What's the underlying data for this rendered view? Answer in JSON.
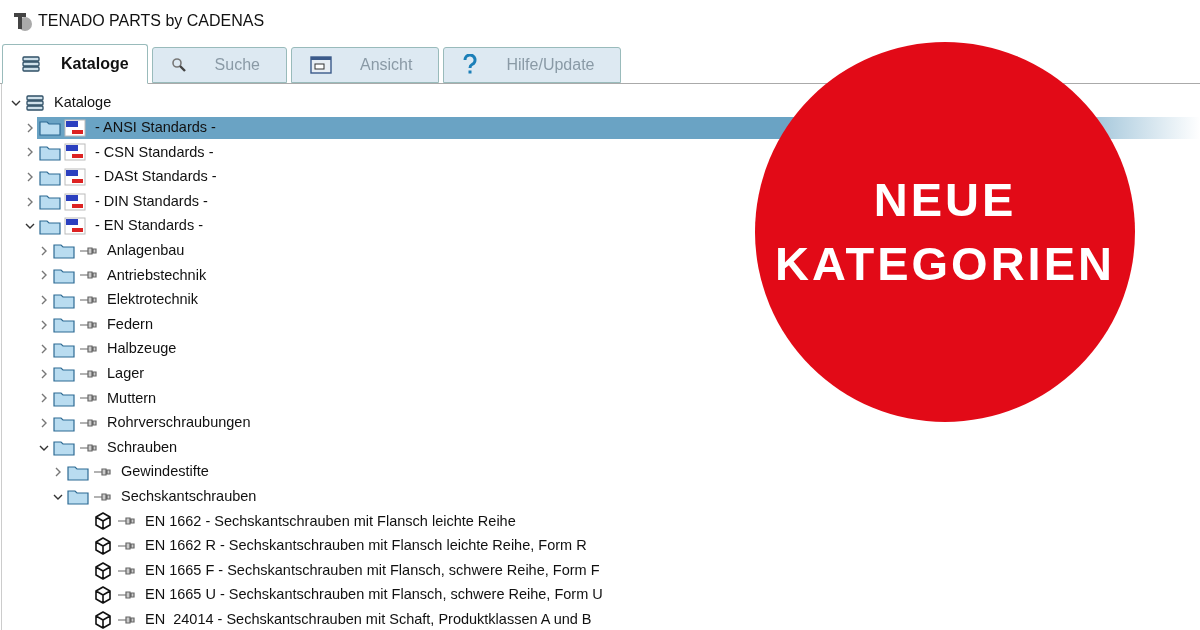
{
  "window": {
    "title": "TENADO PARTS by CADENAS"
  },
  "tabs": [
    {
      "label": "Kataloge",
      "selected": true,
      "kind": "books"
    },
    {
      "label": "Suche",
      "selected": false,
      "kind": "search"
    },
    {
      "label": "Ansicht",
      "selected": false,
      "kind": "view"
    },
    {
      "label": "Hilfe/Update",
      "selected": false,
      "kind": "help"
    }
  ],
  "tree": [
    {
      "label": "Kataloge",
      "kind": "catalog",
      "expanded": true,
      "selected": false,
      "children": [
        {
          "label": "- ANSI Standards -",
          "kind": "standard",
          "expanded": false,
          "selected": true
        },
        {
          "label": "- CSN Standards -",
          "kind": "standard",
          "expanded": false,
          "selected": false
        },
        {
          "label": "- DASt Standards -",
          "kind": "standard",
          "expanded": false,
          "selected": false
        },
        {
          "label": "- DIN Standards -",
          "kind": "standard",
          "expanded": false,
          "selected": false
        },
        {
          "label": "- EN Standards -",
          "kind": "standard",
          "expanded": true,
          "selected": false,
          "children": [
            {
              "label": "Anlagenbau",
              "kind": "folder",
              "expanded": false,
              "selected": false
            },
            {
              "label": "Antriebstechnik",
              "kind": "folder",
              "expanded": false,
              "selected": false
            },
            {
              "label": "Elektrotechnik",
              "kind": "folder",
              "expanded": false,
              "selected": false
            },
            {
              "label": "Federn",
              "kind": "folder",
              "expanded": false,
              "selected": false
            },
            {
              "label": "Halbzeuge",
              "kind": "folder",
              "expanded": false,
              "selected": false
            },
            {
              "label": "Lager",
              "kind": "folder",
              "expanded": false,
              "selected": false
            },
            {
              "label": "Muttern",
              "kind": "folder",
              "expanded": false,
              "selected": false
            },
            {
              "label": "Rohrverschraubungen",
              "kind": "folder",
              "expanded": false,
              "selected": false
            },
            {
              "label": "Schrauben",
              "kind": "folder",
              "expanded": true,
              "selected": false,
              "children": [
                {
                  "label": "Gewindestifte",
                  "kind": "folder",
                  "expanded": false,
                  "selected": false
                },
                {
                  "label": "Sechskantschrauben",
                  "kind": "folder",
                  "expanded": true,
                  "selected": false,
                  "children": [
                    {
                      "label": "EN 1662 - Sechskantschrauben mit Flansch leichte Reihe",
                      "kind": "part",
                      "selected": false
                    },
                    {
                      "label": "EN 1662 R - Sechskantschrauben mit Flansch leichte Reihe, Form R",
                      "kind": "part",
                      "selected": false
                    },
                    {
                      "label": "EN 1665 F - Sechskantschrauben mit Flansch, schwere Reihe, Form F",
                      "kind": "part",
                      "selected": false
                    },
                    {
                      "label": "EN 1665 U - Sechskantschrauben mit Flansch, schwere Reihe, Form U",
                      "kind": "part",
                      "selected": false
                    },
                    {
                      "label": "EN  24014 - Sechskantschrauben mit Schaft, Produktklassen A und B",
                      "kind": "part",
                      "selected": false
                    }
                  ]
                }
              ]
            }
          ]
        }
      ]
    }
  ],
  "banner": {
    "lines": [
      "NEUE",
      "KATEGORIEN"
    ]
  }
}
